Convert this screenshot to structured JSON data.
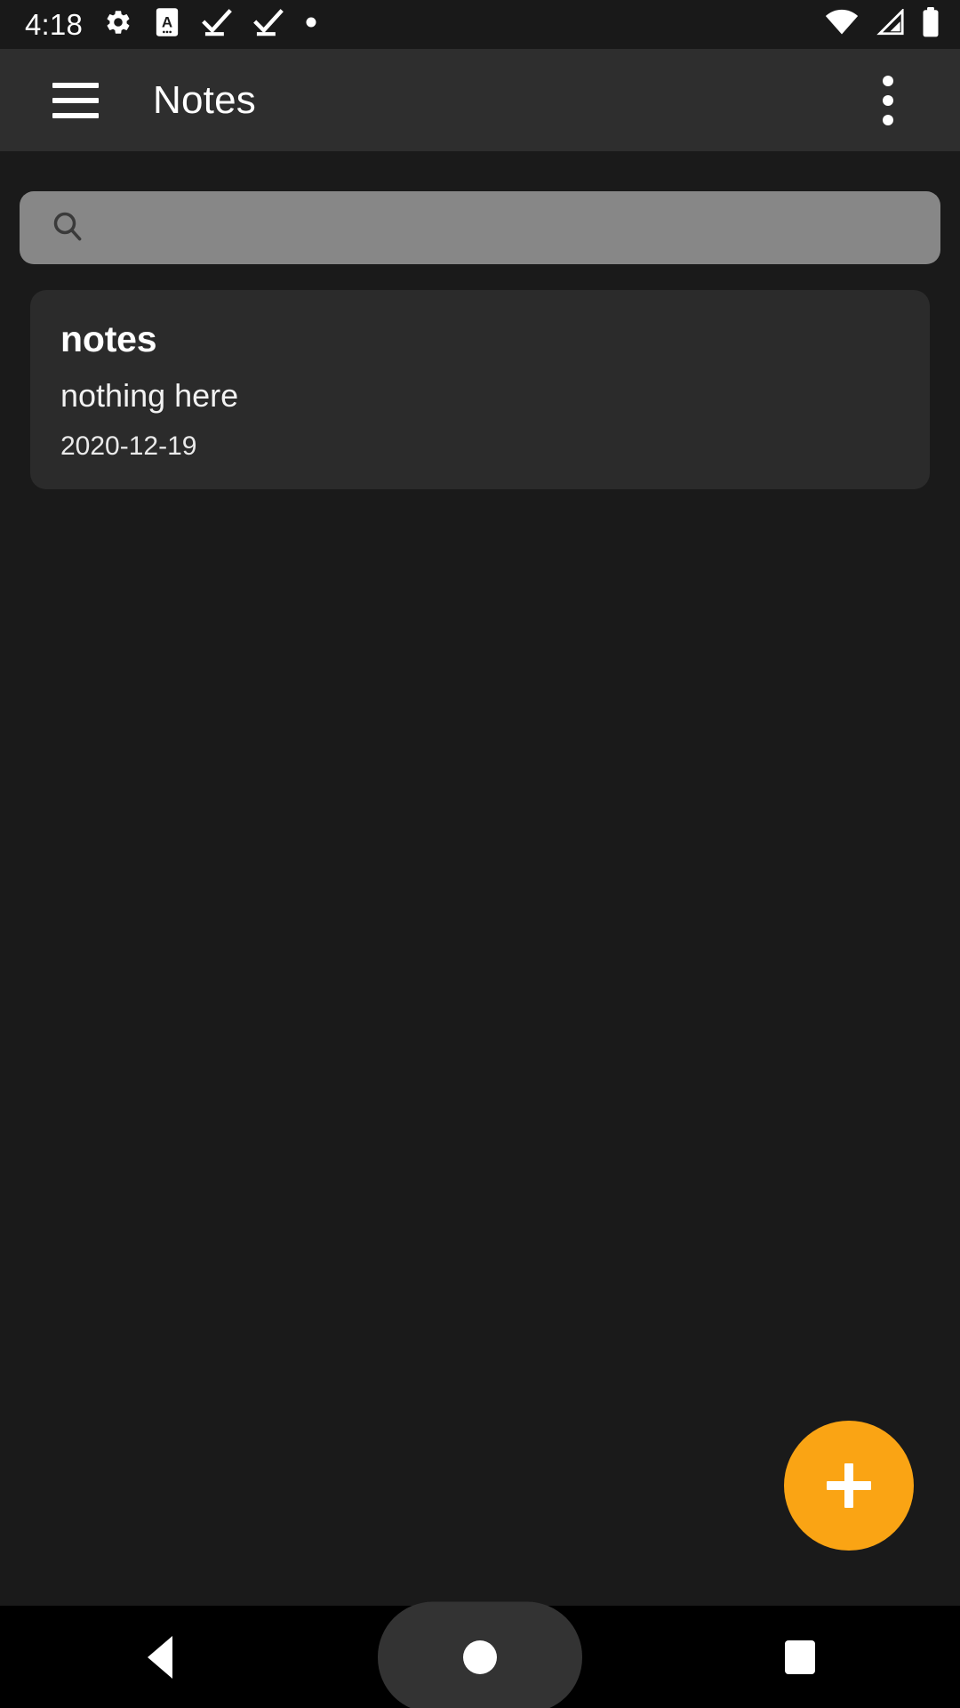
{
  "status_bar": {
    "time": "4:18",
    "left_icons": [
      {
        "name": "settings-gear-icon",
        "label": "settings"
      },
      {
        "name": "document-a-icon",
        "label": "document"
      },
      {
        "name": "check-underline-icon-1",
        "label": "task-complete"
      },
      {
        "name": "check-underline-icon-2",
        "label": "task-complete"
      },
      {
        "name": "dot-icon",
        "label": "more-notifications"
      }
    ],
    "right_icons": [
      {
        "name": "wifi-icon",
        "label": "wifi"
      },
      {
        "name": "cellular-signal-icon",
        "label": "signal"
      },
      {
        "name": "battery-icon",
        "label": "battery"
      }
    ]
  },
  "app_bar": {
    "menu_label": "Open navigation drawer",
    "title": "Notes",
    "overflow_label": "More options"
  },
  "search": {
    "value": "",
    "placeholder": "",
    "icon": "search-icon"
  },
  "notes": [
    {
      "title": "notes",
      "body": "nothing here",
      "date": "2020-12-19"
    }
  ],
  "fab": {
    "label": "+",
    "name": "add-note-button",
    "color": "#faa414"
  },
  "nav_bar": {
    "back_label": "Back",
    "home_label": "Home",
    "recents_label": "Recent apps"
  },
  "colors": {
    "page_background": "#1a1a1a",
    "app_bar": "#2e2e2e",
    "status_bar": "#191919",
    "card": "#2b2b2b",
    "search_field": "#878787",
    "accent": "#faa414",
    "nav_bar": "#000000"
  }
}
